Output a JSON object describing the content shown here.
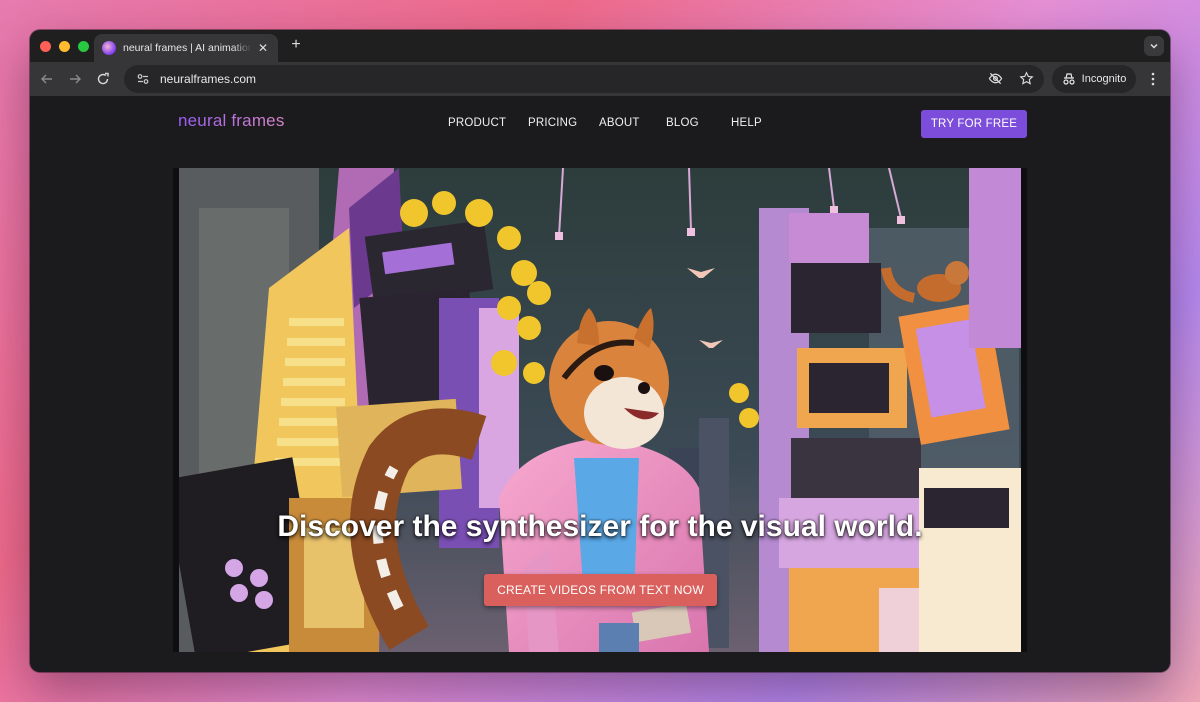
{
  "browser": {
    "tab_title": "neural frames | AI animation generator",
    "url": "neuralframes.com",
    "incognito_label": "Incognito",
    "new_tab_symbol": "+",
    "close_symbol": "✕"
  },
  "site": {
    "logo": "neural frames",
    "nav": [
      "PRODUCT",
      "PRICING",
      "ABOUT",
      "BLOG",
      "HELP"
    ],
    "cta_top": "TRY FOR FREE",
    "accent_color": "#7c4ddb"
  },
  "hero": {
    "headline": "Discover the synthesizer for the visual world.",
    "cta": "CREATE VIDEOS FROM TEXT NOW",
    "cta_color": "#d9605c"
  }
}
